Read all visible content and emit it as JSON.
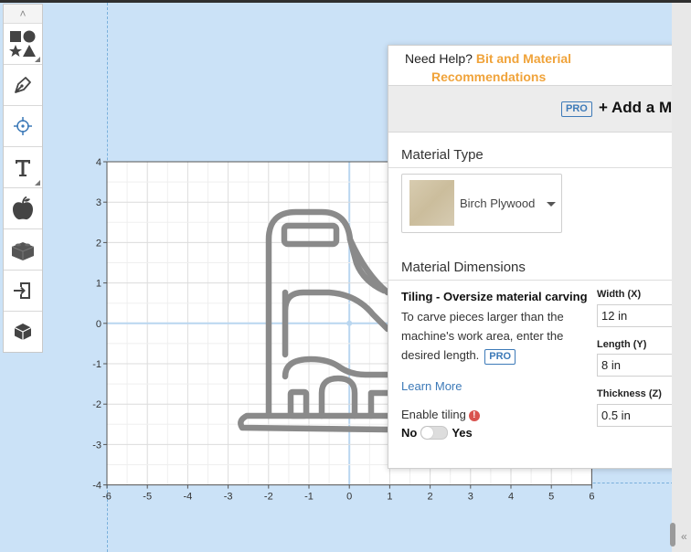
{
  "canvas": {
    "x_ticks": [
      "-6",
      "-5",
      "-4",
      "-3",
      "-2",
      "-1",
      "0",
      "1",
      "2",
      "3",
      "4",
      "5",
      "6"
    ],
    "y_ticks": [
      "4",
      "3",
      "2",
      "1",
      "0",
      "-1",
      "-2",
      "-3",
      "-4"
    ]
  },
  "toolbar": {
    "collapse_icon": "double-chevron-up-icon",
    "tools": [
      "shapes-icon",
      "pen-icon",
      "target-icon",
      "text-icon",
      "apple-icon",
      "lego-brick-icon",
      "import-icon",
      "box-3d-icon"
    ]
  },
  "panel": {
    "help_text": "Need Help?",
    "help_link_line1": "Bit and Material",
    "help_link_line2": "Recommendations",
    "pro_badge": "PRO",
    "add_material_label": "+ Add a Mate",
    "material_type_title": "Material Type",
    "material_selected": "Birch Plywood",
    "material_dimensions_title": "Material Dimensions",
    "tiling_title": "Tiling - Oversize material carving",
    "tiling_description": "To carve pieces larger than the machine's work area, enter the desired length.",
    "learn_more": "Learn More",
    "enable_tiling": "Enable tiling",
    "toggle_off": "No",
    "toggle_on": "Yes",
    "tiling_enabled": false,
    "width_label": "Width (X)",
    "width_value": "12 in",
    "length_label": "Length (Y)",
    "length_value": "8 in",
    "thickness_label": "Thickness (Z)",
    "thickness_value": "0.5 in"
  },
  "colors": {
    "accent_link": "#f0a33a",
    "pro_blue": "#3d7ab8",
    "workspace_bg": "#cbe2f7",
    "shape_stroke": "#8a8a8a"
  }
}
